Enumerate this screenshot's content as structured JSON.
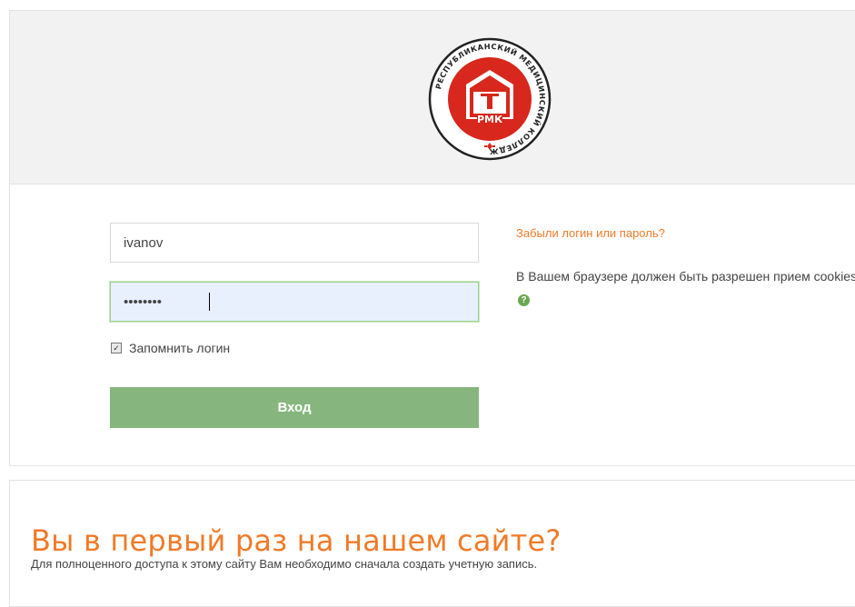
{
  "logo": {
    "arc_text": "РЕСПУБЛИКАНСКИЙ МЕДИЦИНСКИЙ КОЛЛЕДЖ",
    "abbr": "РМК",
    "colors": {
      "red": "#d8271c",
      "dark": "#222222"
    }
  },
  "login": {
    "username_value": "ivanov",
    "password_value": "••••••••",
    "remember_label": "Запомнить логин",
    "remember_checked": true,
    "submit_label": "Вход",
    "forgot_link": "Забыли логин или пароль?",
    "cookies_text": "В Вашем браузере должен быть разрешен прием cookies",
    "help_icon": "question-circle-icon"
  },
  "signup": {
    "title": "Вы в первый раз на нашем сайте?",
    "text": "Для полноценного доступа к этому сайту Вам необходимо сначала создать учетную запись."
  },
  "colors": {
    "accent_orange": "#f07a28",
    "button_green": "#86b67d",
    "band_gray": "#f2f2f2",
    "autofill_blue": "#e8f0fe"
  }
}
